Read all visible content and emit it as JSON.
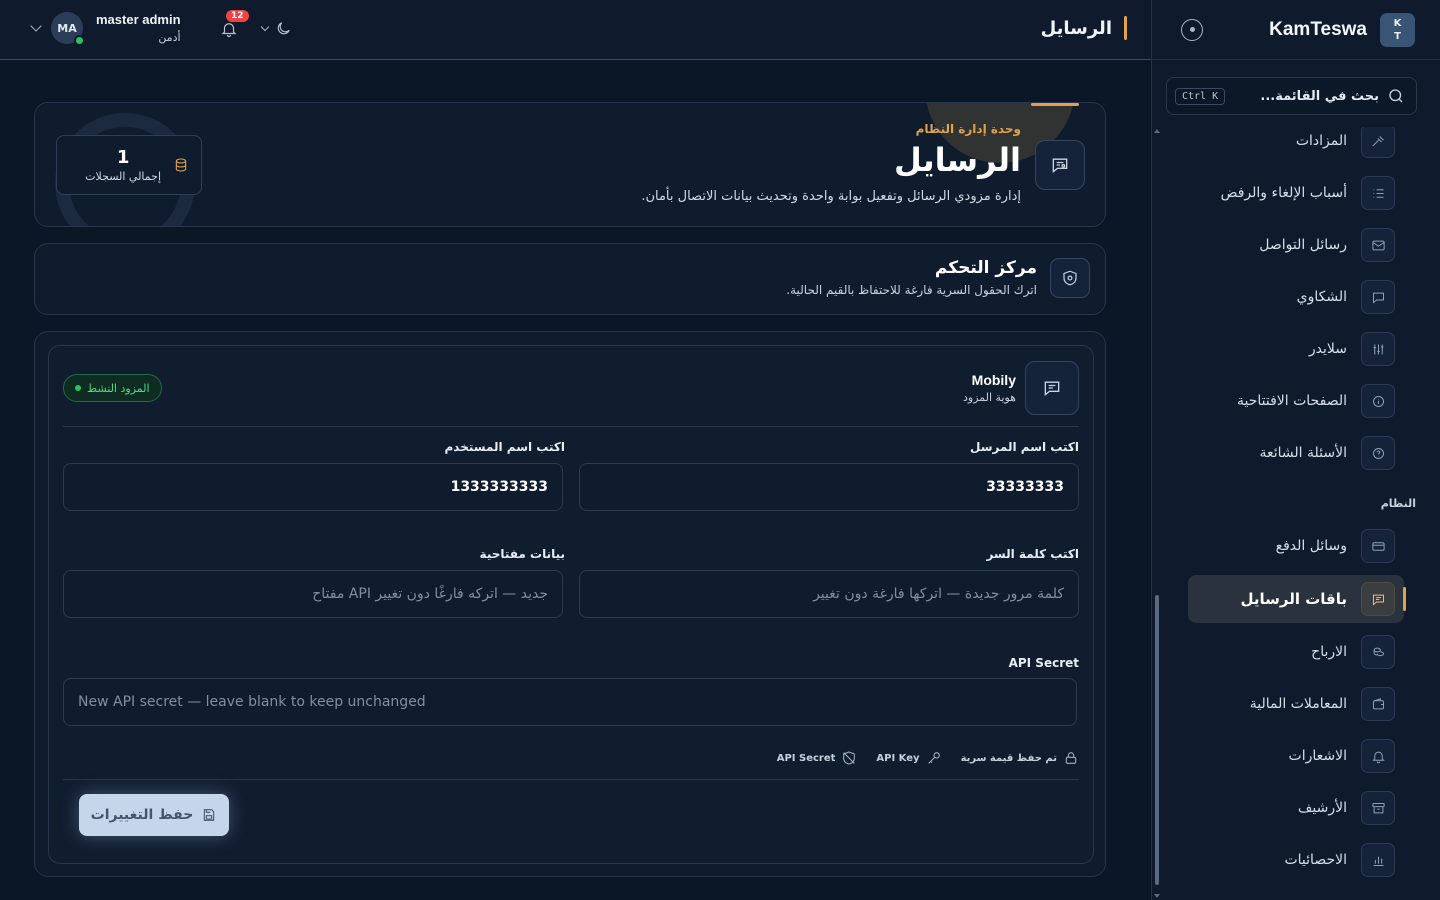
{
  "topbar": {
    "page_title": "الرسايل",
    "user_name": "master admin",
    "user_role": "أدمن",
    "avatar_initials": "MA",
    "notification_count": "12",
    "icons": [
      "bell-icon",
      "moon-icon",
      "chevron-down-icon"
    ]
  },
  "sidebar": {
    "brand_name": "KamTeswa",
    "logo_line1": "K",
    "logo_line2": "T",
    "search_placeholder": "بحث في القائمة...",
    "search_shortcut": "Ctrl K",
    "items_top": [
      {
        "label": "المزادات",
        "icon": "gavel-icon"
      },
      {
        "label": "أسباب الإلغاء والرفض",
        "icon": "list-icon"
      },
      {
        "label": "رسائل التواصل",
        "icon": "mail-icon"
      },
      {
        "label": "الشكاوي",
        "icon": "chat-icon"
      },
      {
        "label": "سلايدر",
        "icon": "sliders-icon"
      },
      {
        "label": "الصفحات الافتتاحية",
        "icon": "info-icon"
      },
      {
        "label": "الأسئلة الشائعة",
        "icon": "help-icon"
      }
    ],
    "section_system": "النظام",
    "items_system": [
      {
        "label": "وسائل الدفع",
        "icon": "card-icon"
      },
      {
        "label": "باقات الرسايل",
        "icon": "message-icon",
        "active": true
      },
      {
        "label": "الارباح",
        "icon": "coins-icon"
      },
      {
        "label": "المعاملات المالية",
        "icon": "wallet-icon"
      },
      {
        "label": "الاشعارات",
        "icon": "bell-icon"
      },
      {
        "label": "الأرشيف",
        "icon": "archive-icon"
      },
      {
        "label": "الاحصائيات",
        "icon": "chart-icon"
      }
    ]
  },
  "hero": {
    "eyebrow": "وحدة إدارة النظام",
    "title": "الرسايل",
    "description": "إدارة مزودي الرسائل وتفعيل بوابة واحدة وتحديث بيانات الاتصال بأمان.",
    "stat_value": "1",
    "stat_label": "إجمالي السجلات"
  },
  "control_center": {
    "title": "مركز التحكم",
    "description": "اترك الحقول السرية فارغة للاحتفاظ بالقيم الحالية."
  },
  "provider": {
    "name": "Mobily",
    "subtitle": "هوية المزود",
    "status": "المزود النشط",
    "fields": {
      "sender_label": "اكتب اسم المرسل",
      "sender_value": "33333333",
      "username_label": "اكتب اسم المستخدم",
      "username_value": "1333333333",
      "password_label": "اكتب كلمة السر",
      "password_placeholder": "كلمة مرور جديدة — اتركها فارغة دون تغيير",
      "api_key_label": "بيانات مفتاحية",
      "api_key_placeholder": "جديد — اتركه فارغًا دون تغيير API مفتاح",
      "api_secret_label": "API Secret",
      "api_secret_placeholder": "New API secret — leave blank to keep unchanged"
    },
    "chips": {
      "saved_secret": "تم حفظ قيمة سرية",
      "api_key": "API Key",
      "api_secret": "API Secret"
    },
    "save_label": "حفظ التغييرات"
  },
  "colors": {
    "accent": "#e3a14a",
    "background": "#0b1626",
    "success": "#22c55e"
  }
}
